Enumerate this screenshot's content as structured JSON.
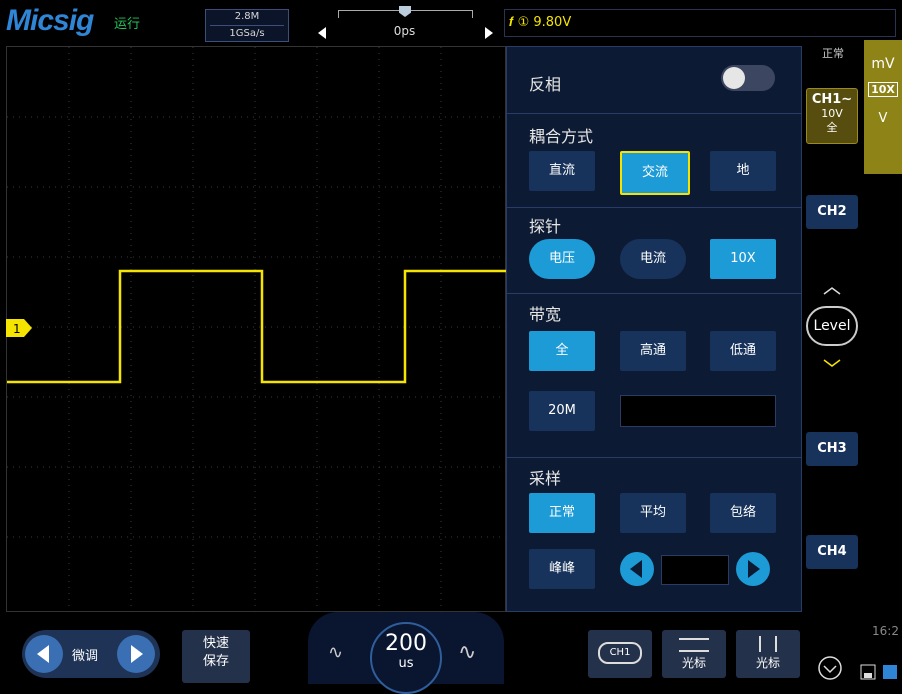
{
  "header": {
    "logo": "Micsig",
    "run_status": "运行",
    "memory_depth": "2.8M",
    "sample_rate": "1GSa/s",
    "delay": "0ps",
    "trigger_info": "𝒇 ① 9.80V",
    "acq_mode_label": "正常"
  },
  "panel": {
    "invert": {
      "label": "反相",
      "enabled": false
    },
    "coupling": {
      "title": "耦合方式",
      "options": [
        "直流",
        "交流",
        "地"
      ],
      "selected": "交流"
    },
    "probe": {
      "title": "探针",
      "options": [
        "电压",
        "电流",
        "10X"
      ],
      "selected": "电压"
    },
    "bandwidth": {
      "title": "带宽",
      "options": [
        "全",
        "高通",
        "低通",
        "20M"
      ],
      "selected": "全",
      "custom_value": ""
    },
    "sampling": {
      "title": "采样",
      "options": [
        "正常",
        "平均",
        "包络",
        "峰峰"
      ],
      "selected": "正常",
      "value": ""
    }
  },
  "sidebar": {
    "ch1": {
      "name": "CH1∼",
      "volts": "10V",
      "bw": "全"
    },
    "ch2": "CH2",
    "ch3": "CH3",
    "ch4": "CH4",
    "level": "Level",
    "probe_unit": "mV",
    "probe_ratio": "10X",
    "probe_v": "V"
  },
  "footer": {
    "fine_tune": "微调",
    "quick_save": "快速\n保存",
    "timebase_value": "200",
    "timebase_unit": "us",
    "ch1_button": "CH1",
    "cursor1": "光标",
    "cursor2": "光标",
    "clock": "16:2"
  },
  "waveform": {
    "channel": "1",
    "color": "#f4e400"
  }
}
